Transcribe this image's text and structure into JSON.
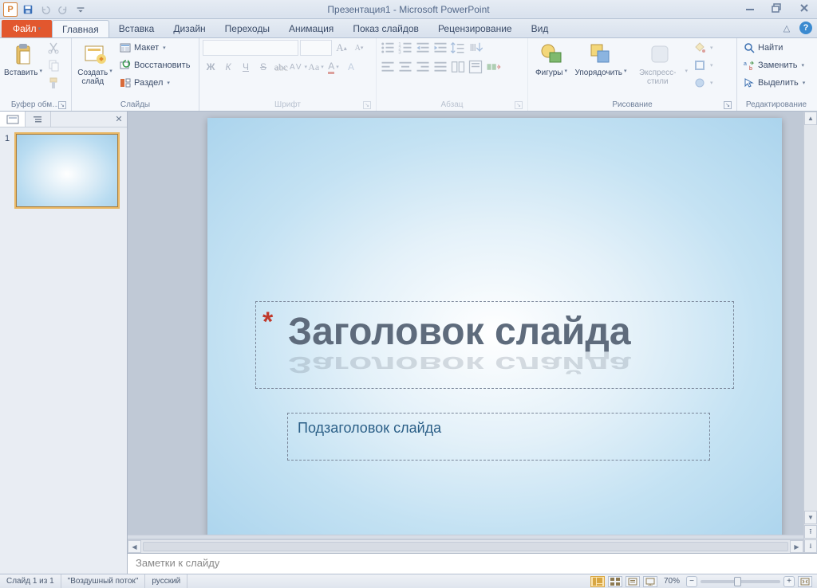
{
  "title": "Презентация1 - Microsoft PowerPoint",
  "tabs": {
    "file": "Файл",
    "home": "Главная",
    "insert": "Вставка",
    "design": "Дизайн",
    "transitions": "Переходы",
    "animations": "Анимация",
    "slideshow": "Показ слайдов",
    "review": "Рецензирование",
    "view": "Вид"
  },
  "groups": {
    "clipboard": {
      "label": "Буфер обм…",
      "paste": "Вставить"
    },
    "slides": {
      "label": "Слайды",
      "new": "Создать\nслайд",
      "layout": "Макет",
      "reset": "Восстановить",
      "section": "Раздел"
    },
    "font": {
      "label": "Шрифт",
      "name_ph": "",
      "size_ph": ""
    },
    "paragraph": {
      "label": "Абзац"
    },
    "drawing": {
      "label": "Рисование",
      "shapes": "Фигуры",
      "arrange": "Упорядочить",
      "styles": "Экспресс-стили"
    },
    "editing": {
      "label": "Редактирование",
      "find": "Найти",
      "replace": "Заменить",
      "select": "Выделить"
    }
  },
  "slide": {
    "number": "1",
    "title_placeholder": "Заголовок слайда",
    "subtitle_placeholder": "Подзаголовок слайда"
  },
  "notes_placeholder": "Заметки к слайду",
  "status": {
    "slide_pos": "Слайд 1 из 1",
    "theme": "\"Воздушный поток\"",
    "lang": "русский",
    "zoom": "70%"
  }
}
